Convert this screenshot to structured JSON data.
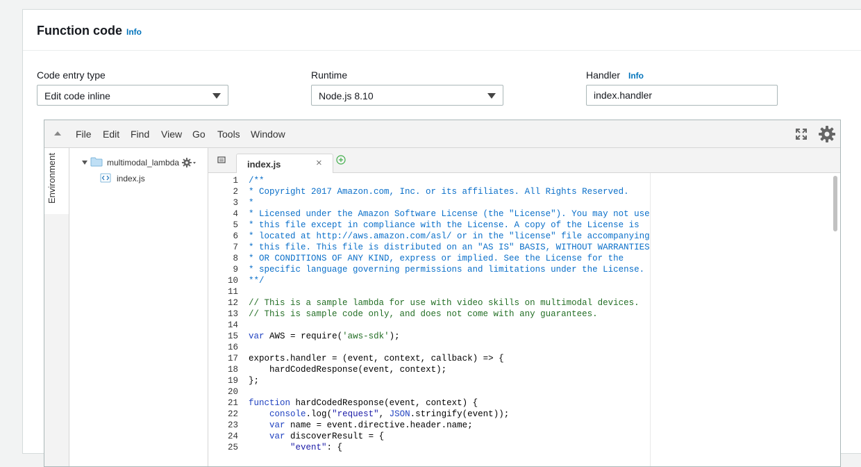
{
  "section": {
    "title": "Function code",
    "info_label": "Info"
  },
  "fields": {
    "code_entry_type": {
      "label": "Code entry type",
      "value": "Edit code inline"
    },
    "runtime": {
      "label": "Runtime",
      "value": "Node.js 8.10"
    },
    "handler": {
      "label": "Handler",
      "info_label": "Info",
      "value": "index.handler"
    }
  },
  "ide": {
    "menu": [
      "File",
      "Edit",
      "Find",
      "View",
      "Go",
      "Tools",
      "Window"
    ],
    "sidebar_tab": "Environment",
    "tree": {
      "folder": "multimodal_lambda",
      "file": "index.js"
    },
    "active_tab": {
      "label": "index.js",
      "close": "×"
    },
    "code_lines": [
      "/**",
      "* Copyright 2017 Amazon.com, Inc. or its affiliates. All Rights Reserved.",
      "*",
      "* Licensed under the Amazon Software License (the \"License\"). You may not use",
      "* this file except in compliance with the License. A copy of the License is",
      "* located at http://aws.amazon.com/asl/ or in the \"license\" file accompanying",
      "* this file. This file is distributed on an \"AS IS\" BASIS, WITHOUT WARRANTIES",
      "* OR CONDITIONS OF ANY KIND, express or implied. See the License for the",
      "* specific language governing permissions and limitations under the License.",
      "**/",
      "",
      "// This is a sample lambda for use with video skills on multimodal devices.",
      "// This is sample code only, and does not come with any guarantees.",
      "",
      "var AWS = require('aws-sdk');",
      "",
      "exports.handler = (event, context, callback) => {",
      "    hardCodedResponse(event, context);",
      "};",
      "",
      "function hardCodedResponse(event, context) {",
      "    console.log(\"request\", JSON.stringify(event));",
      "    var name = event.directive.header.name;",
      "    var discoverResult = {",
      "        \"event\": {"
    ]
  },
  "colors": {
    "accent": "#0073bb",
    "doc_comment": "#0a6fc9",
    "line_comment": "#236e25",
    "keyword": "#1f41c0"
  }
}
